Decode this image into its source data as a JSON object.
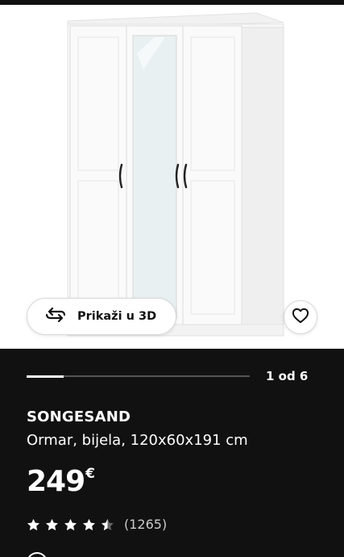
{
  "product": {
    "view_3d_label": "Prikaži u 3D",
    "carousel": {
      "current": 1,
      "total": 6,
      "label": "1 od 6"
    },
    "name": "SONGESAND",
    "description": "Ormar, bijela, 120x60x191 cm",
    "price": {
      "amount": "249",
      "currency": "€"
    },
    "rating": {
      "value": 4.5,
      "max": 5,
      "count_label": "(1265)"
    }
  },
  "icons": {
    "view_3d": "rotate-3d-icon",
    "favourite": "heart-outline-icon",
    "star": "star-icon"
  },
  "colors": {
    "panel_bg": "#111111",
    "hero_bg": "#ffffff",
    "text": "#ffffff"
  }
}
